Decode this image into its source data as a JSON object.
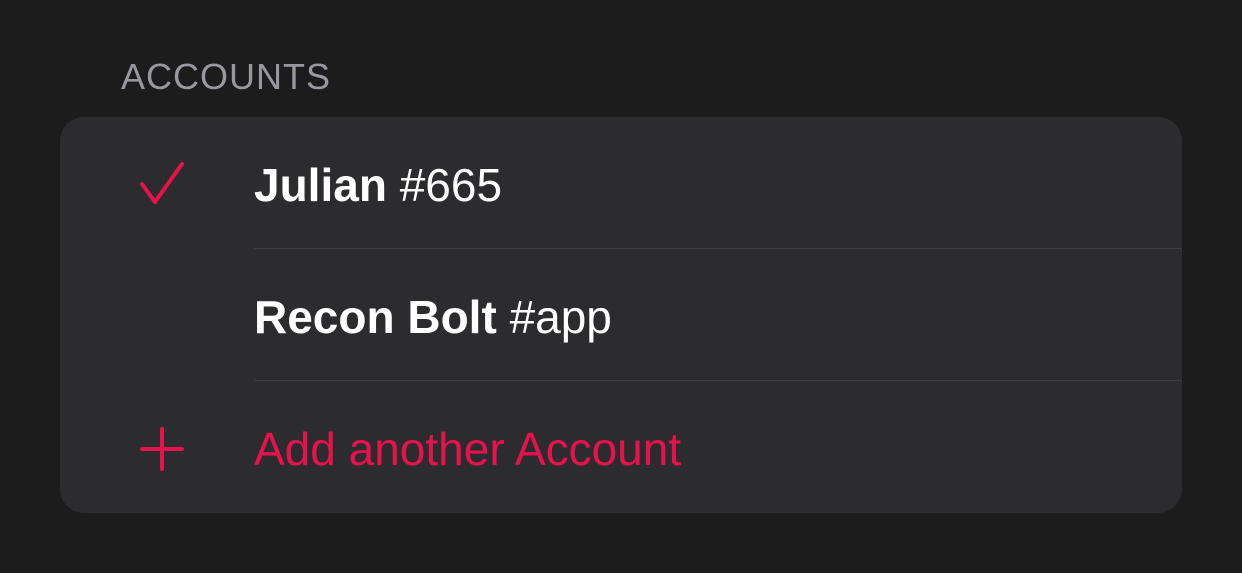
{
  "section": {
    "title": "ACCOUNTS"
  },
  "accounts": [
    {
      "name": "Julian",
      "tag": "#665",
      "selected": true,
      "icon": "checkmark-icon"
    },
    {
      "name": "Recon Bolt",
      "tag": "#app",
      "selected": false
    }
  ],
  "add_account": {
    "label": "Add another Account",
    "icon": "plus-icon"
  },
  "colors": {
    "accent": "#e8114f",
    "background": "#1c1c1d",
    "card": "#2c2c2e",
    "separator": "#3d3d40",
    "header_text": "#98989e",
    "primary_text": "#ffffff"
  }
}
